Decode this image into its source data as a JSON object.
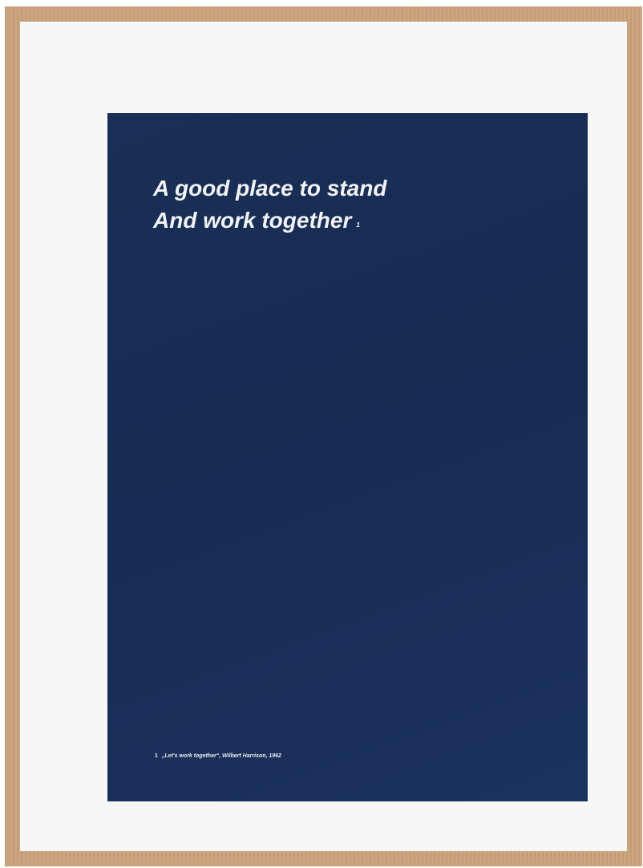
{
  "poster": {
    "headline_line1": "A good place to stand",
    "headline_line2": "And work together",
    "headline_marker": "1",
    "footnote_number": "1",
    "footnote_text": "„Let's work together“, Wilbert Harrison, 1962",
    "background_color": "#172b52",
    "text_color": "#f2f3f6"
  },
  "frame": {
    "wood_color": "#c9a27c",
    "mat_color": "#f7f7f7"
  }
}
